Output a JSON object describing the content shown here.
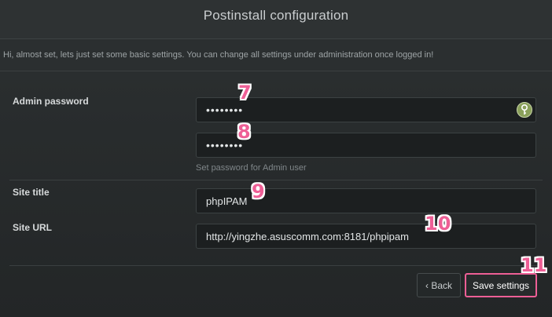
{
  "header": {
    "title": "Postinstall configuration"
  },
  "notice": "Hi, almost set, lets just set some basic settings. You can change all settings under administration once logged in!",
  "form": {
    "admin_password_label": "Admin password",
    "password_value": "••••••••",
    "password_confirm_value": "••••••••",
    "password_hint": "Set password for Admin user",
    "site_title_label": "Site title",
    "site_title_value": "phpIPAM",
    "site_url_label": "Site URL",
    "site_url_value": "http://yingzhe.asuscomm.com:8181/phpipam"
  },
  "buttons": {
    "back": "‹ Back",
    "save": "Save settings"
  },
  "annotations": {
    "m7": "7",
    "m8": "8",
    "m9": "9",
    "m10": "10",
    "m11": "11"
  },
  "colors": {
    "highlight": "#ee5f96",
    "key_icon": "#8aa05b"
  },
  "icons": {
    "password_generator": "key-icon"
  }
}
